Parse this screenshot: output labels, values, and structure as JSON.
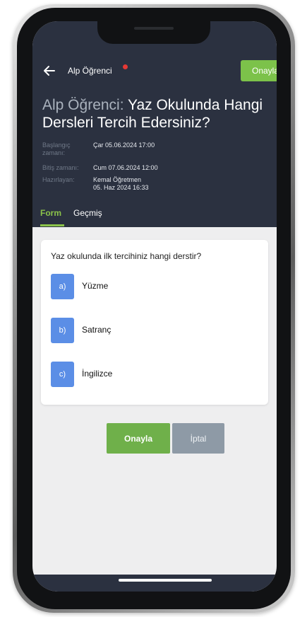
{
  "nav": {
    "title": "Alp Öğrenci",
    "approve_label": "Onayla"
  },
  "header": {
    "title_prefix": "Alp Öğrenci: ",
    "title_main": "Yaz Okulunda Hangi Dersleri Tercih Edersiniz?",
    "meta": [
      {
        "label": "Başlangıç zamanı:",
        "value": "Çar 05.06.2024 17:00"
      },
      {
        "label": "Bitiş zamanı:",
        "value": "Cum 07.06.2024 12:00"
      },
      {
        "label": "Hazırlayan:",
        "value": "Kemal Öğretmen\n05. Haz 2024 16:33"
      }
    ]
  },
  "tabs": [
    {
      "label": "Form",
      "active": true
    },
    {
      "label": "Geçmiş",
      "active": false
    }
  ],
  "form": {
    "question": "Yaz okulunda ilk tercihiniz hangi derstir?",
    "options": [
      {
        "letter": "a)",
        "text": "Yüzme"
      },
      {
        "letter": "b)",
        "text": "Satranç"
      },
      {
        "letter": "c)",
        "text": "İngilizce"
      }
    ]
  },
  "actions": {
    "approve_label": "Onayla",
    "cancel_label": "İptal"
  },
  "colors": {
    "header_bg": "#2b3140",
    "accent_green": "#7cc24a",
    "option_blue": "#5b8ee6",
    "cancel_gray": "#8e9aa6",
    "notification_red": "#e53935"
  }
}
